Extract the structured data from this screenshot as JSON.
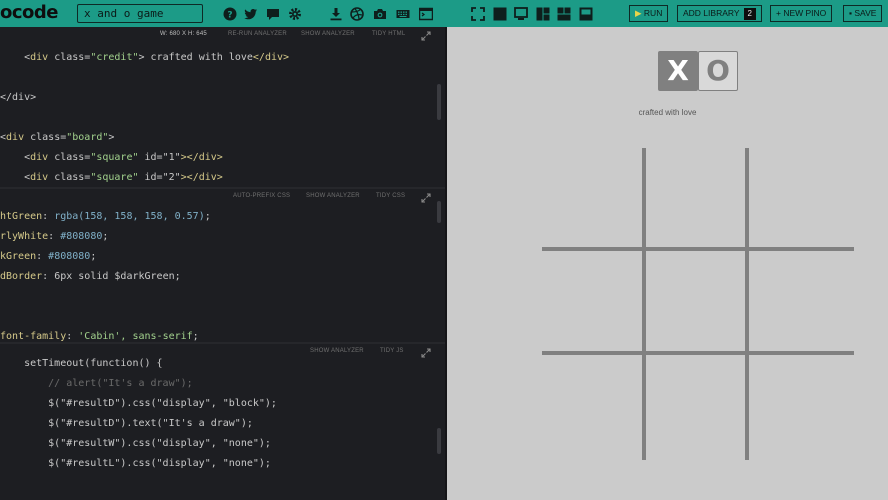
{
  "topbar": {
    "logo_text": "ocode",
    "search_value": "x and o game",
    "icons": [
      "help-icon",
      "twitter-icon",
      "comment-icon",
      "gear-icon",
      "download-icon",
      "dribbble-icon",
      "camera-icon",
      "keyboard-icon",
      "terminal-icon",
      "fullscreen-icon",
      "layout-full-icon",
      "layout-screen-icon",
      "layout-split-icon",
      "layout-tiles-icon",
      "layout-bottom-icon"
    ],
    "run_label": "RUN",
    "add_library_label": "ADD LIBRARY",
    "library_count": "2",
    "new_pino_label": "+ NEW PINO",
    "save_label": "SAVE"
  },
  "html_pane": {
    "dims": "W: 680 x H: 645",
    "btn_rerun": "RE-RUN ANALYZER",
    "btn_analyzer": "SHOW ANALYZER",
    "btn_tidy": "TIDY HTML",
    "lines": [
      {
        "pre": "    <",
        "tag": "div",
        "attr": " class=",
        "str": "\"credit\"",
        "close": ">",
        "text": " crafted with love",
        "end": "</div>"
      },
      {
        "pre": "",
        "tag": "",
        "attr": "",
        "str": "",
        "close": "",
        "text": "",
        "end": ""
      },
      {
        "pre": "",
        "tag": "",
        "attr": "",
        "str": "",
        "close": "",
        "text": "</div>",
        "end": ""
      },
      {
        "pre": "",
        "tag": "",
        "attr": "",
        "str": "",
        "close": "",
        "text": "",
        "end": ""
      },
      {
        "pre": "<",
        "tag": "div",
        "attr": " class=",
        "str": "\"board\"",
        "close": ">",
        "text": "",
        "end": ""
      },
      {
        "pre": "    <",
        "tag": "div",
        "attr": " class=",
        "str": "\"square\"",
        "close": "",
        "text": " id=\"1\"",
        "end": "></div>"
      },
      {
        "pre": "    <",
        "tag": "div",
        "attr": " class=",
        "str": "\"square\"",
        "close": "",
        "text": " id=\"2\"",
        "end": "></div>"
      }
    ]
  },
  "css_pane": {
    "btn_autoprefix": "AUTO-PREFIX CSS",
    "btn_analyzer": "SHOW ANALYZER",
    "btn_tidy": "TIDY CSS",
    "lines": [
      {
        "name": "htGreen",
        "colon": ": ",
        "value": "rgba(158, 158, 158, 0.57)",
        "end": ";"
      },
      {
        "name": "rlyWhite",
        "colon": ": ",
        "value": "#808080",
        "end": ";"
      },
      {
        "name": "kGreen",
        "colon": ": ",
        "value": "#808080",
        "end": ";"
      },
      {
        "name": "dBorder",
        "colon": ": ",
        "value": "6px solid $darkGreen",
        "end": ";"
      },
      {
        "name": "",
        "colon": "",
        "value": "",
        "end": ""
      },
      {
        "name": "",
        "colon": "",
        "value": "",
        "end": ""
      },
      {
        "name": "font-family",
        "colon": ": ",
        "value": "'Cabin', sans-serif",
        "end": ";"
      }
    ]
  },
  "js_pane": {
    "btn_analyzer": "SHOW ANALYZER",
    "btn_tidy": "TIDY JS",
    "lines": [
      "    setTimeout(function() {",
      "        // alert(\"It's a draw\");",
      "        $(\"#resultD\").css(\"display\", \"block\");",
      "        $(\"#resultD\").text(\"It's a draw\");",
      "        $(\"#resultW\").css(\"display\", \"none\");",
      "        $(\"#resultL\").css(\"display\", \"none\");"
    ]
  },
  "preview": {
    "x_label": "X",
    "o_label": "O",
    "credit_text": "crafted with love"
  },
  "colors": {
    "topbar": "#1c9b87",
    "editor_bg": "#1d1e22",
    "preview_bg": "#cbcbcb",
    "grid": "#808080"
  }
}
